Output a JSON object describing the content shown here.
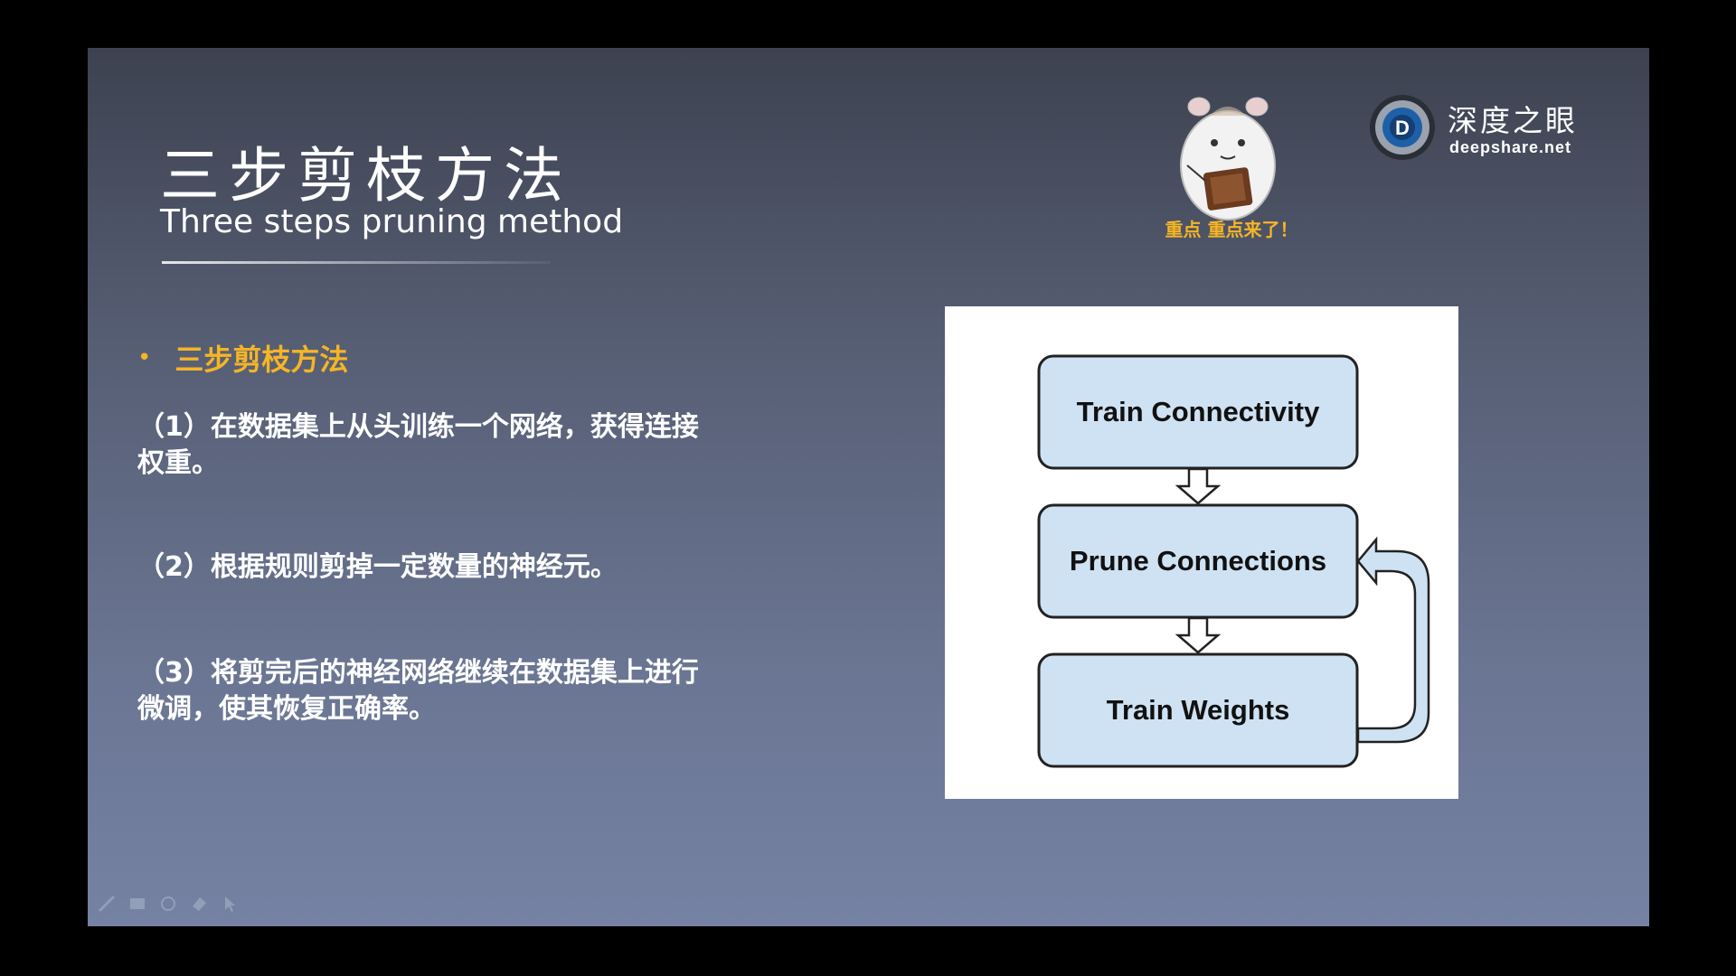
{
  "slide": {
    "title_cn": "三步剪枝方法",
    "title_en": "Three steps pruning method",
    "bullet": "三步剪枝方法",
    "steps": [
      "（1）在数据集上从头训练一个网络，获得连接权重。",
      "（2）根据规则剪掉一定数量的神经元。",
      "（3）将剪完后的神经网络继续在数据集上进行微调，使其恢复正确率。"
    ]
  },
  "mascot": {
    "caption": "重点  重点来了！"
  },
  "brand": {
    "name": "深度之眼",
    "url": "deepshare.net",
    "logo_letter": "D"
  },
  "diagram": {
    "boxes": [
      "Train Connectivity",
      "Prune Connections",
      "Train Weights"
    ]
  },
  "colors": {
    "accent": "#f5b525",
    "box_fill": "#cfe2f3",
    "box_stroke": "#222222"
  },
  "icons": [
    "pen-icon",
    "screen-icon",
    "circle-icon",
    "eraser-icon",
    "pointer-icon"
  ]
}
